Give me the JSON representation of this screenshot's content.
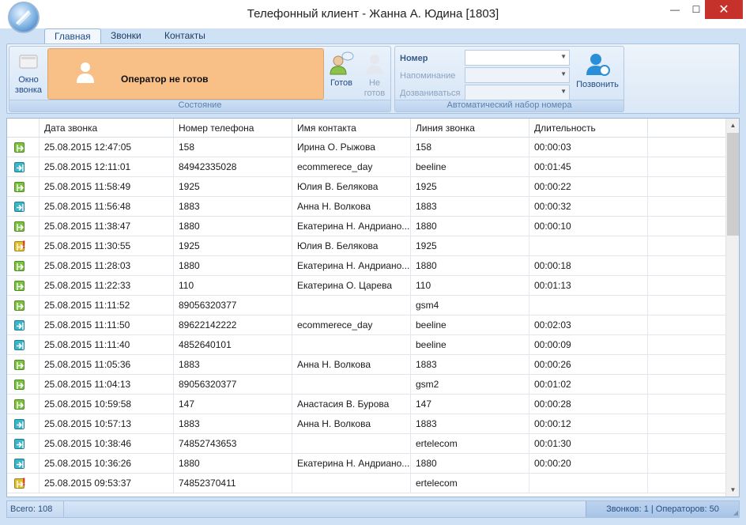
{
  "window": {
    "title": "Телефонный клиент - Жанна А. Юдина [1803]",
    "minimize": "—",
    "maximize": "☐",
    "close": "✕"
  },
  "tabs": [
    "Главная",
    "Звонки",
    "Контакты"
  ],
  "ribbon": {
    "state_group": {
      "caption": "Состояние",
      "window_button": "Окно звонка",
      "status_text": "Оператор не готов",
      "ready_button": "Готов",
      "not_ready_button": "Не готов"
    },
    "dial_group": {
      "caption": "Автоматический набор номера",
      "number_label": "Номер",
      "reminder_label": "Напоминание",
      "redial_label": "Дозваниваться",
      "call_button": "Позвонить"
    }
  },
  "grid": {
    "columns": [
      "",
      "Дата звонка",
      "Номер телефона",
      "Имя контакта",
      "Линия звонка",
      "Длительность",
      ""
    ],
    "rows": [
      {
        "type": "out",
        "date": "25.08.2015 12:47:05",
        "phone": "158",
        "contact": "Ирина О. Рыжова",
        "line": "158",
        "duration": "00:00:03"
      },
      {
        "type": "in",
        "date": "25.08.2015 12:11:01",
        "phone": "84942335028",
        "contact": "ecommerece_day",
        "line": "beeline",
        "duration": "00:01:45"
      },
      {
        "type": "out",
        "date": "25.08.2015 11:58:49",
        "phone": "1925",
        "contact": "Юлия В. Белякова",
        "line": "1925",
        "duration": "00:00:22"
      },
      {
        "type": "in",
        "date": "25.08.2015 11:56:48",
        "phone": "1883",
        "contact": "Анна Н. Волкова",
        "line": "1883",
        "duration": "00:00:32"
      },
      {
        "type": "out",
        "date": "25.08.2015 11:38:47",
        "phone": "1880",
        "contact": "Екатерина Н. Андриано...",
        "line": "1880",
        "duration": "00:00:10"
      },
      {
        "type": "missed",
        "date": "25.08.2015 11:30:55",
        "phone": "1925",
        "contact": "Юлия В. Белякова",
        "line": "1925",
        "duration": ""
      },
      {
        "type": "out",
        "date": "25.08.2015 11:28:03",
        "phone": "1880",
        "contact": "Екатерина Н. Андриано...",
        "line": "1880",
        "duration": "00:00:18"
      },
      {
        "type": "out",
        "date": "25.08.2015 11:22:33",
        "phone": "110",
        "contact": "Екатерина О. Царева",
        "line": "110",
        "duration": "00:01:13"
      },
      {
        "type": "out",
        "date": "25.08.2015 11:11:52",
        "phone": "89056320377",
        "contact": "",
        "line": "gsm4",
        "duration": ""
      },
      {
        "type": "in",
        "date": "25.08.2015 11:11:50",
        "phone": "89622142222",
        "contact": "ecommerece_day",
        "line": "beeline",
        "duration": "00:02:03"
      },
      {
        "type": "in",
        "date": "25.08.2015 11:11:40",
        "phone": "4852640101",
        "contact": "",
        "line": "beeline",
        "duration": "00:00:09"
      },
      {
        "type": "out",
        "date": "25.08.2015 11:05:36",
        "phone": "1883",
        "contact": "Анна Н. Волкова",
        "line": "1883",
        "duration": "00:00:26"
      },
      {
        "type": "out",
        "date": "25.08.2015 11:04:13",
        "phone": "89056320377",
        "contact": "",
        "line": "gsm2",
        "duration": "00:01:02"
      },
      {
        "type": "out",
        "date": "25.08.2015 10:59:58",
        "phone": "147",
        "contact": "Анастасия В. Бурова",
        "line": "147",
        "duration": "00:00:28"
      },
      {
        "type": "in",
        "date": "25.08.2015 10:57:13",
        "phone": "1883",
        "contact": "Анна Н. Волкова",
        "line": "1883",
        "duration": "00:00:12"
      },
      {
        "type": "in",
        "date": "25.08.2015 10:38:46",
        "phone": "74852743653",
        "contact": "",
        "line": "ertelecom",
        "duration": "00:01:30"
      },
      {
        "type": "in",
        "date": "25.08.2015 10:36:26",
        "phone": "1880",
        "contact": "Екатерина Н. Андриано...",
        "line": "1880",
        "duration": "00:00:20"
      },
      {
        "type": "missed",
        "date": "25.08.2015 09:53:37",
        "phone": "74852370411",
        "contact": "",
        "line": "ertelecom",
        "duration": ""
      }
    ]
  },
  "statusbar": {
    "total": "Всего: 108",
    "summary": "Звонков: 1 | Операторов: 50"
  },
  "colors": {
    "status_not_ready": "#f8c087",
    "outgoing": "#7cc142",
    "incoming": "#3ab6c8",
    "missed": "#e0c030"
  }
}
